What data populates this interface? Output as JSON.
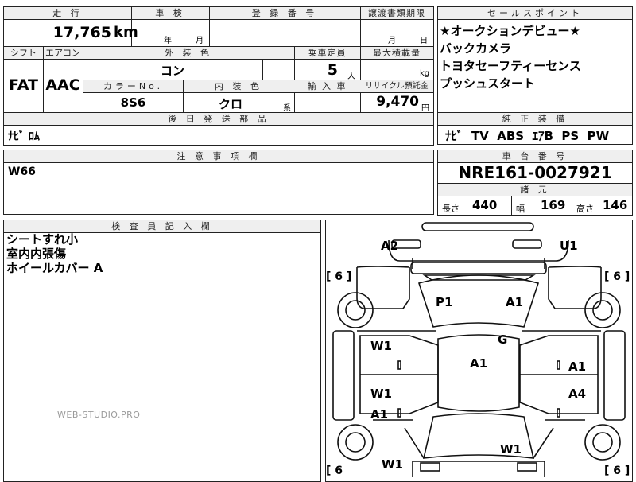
{
  "top": {
    "mileage_label": "走 行",
    "mileage_value": "17,765",
    "mileage_unit": "km",
    "shaken_label": "車 検",
    "shaken_year_unit": "年",
    "shaken_month_unit": "月",
    "reg_label": "登 録 番 号",
    "transfer_label": "譲渡書類期限",
    "transfer_month_unit": "月",
    "transfer_day_unit": "日"
  },
  "row2": {
    "shift_label": "シフト",
    "shift_value": "FAT",
    "ac_label": "エアコン",
    "ac_value": "AAC",
    "exterior_label": "外 装 色",
    "exterior_value": "コン",
    "capacity_label": "乗車定員",
    "capacity_value": "5",
    "capacity_unit": "人",
    "maxload_label": "最大積載量",
    "maxload_unit": "kg",
    "colorno_label": "カラーNo.",
    "colorno_value": "8S6",
    "interior_label": "内 装 色",
    "interior_value": "クロ",
    "interior_suffix": "系",
    "import_label": "輸 入 車",
    "recycle_label": "リサイクル預託金",
    "recycle_value": "9,470",
    "recycle_unit": "円"
  },
  "later": {
    "label": "後 日 発 送 部 品",
    "value": "ﾅﾋﾞ ﾛﾑ"
  },
  "notes": {
    "label": "注 意 事 項 欄",
    "value": "W66"
  },
  "inspector": {
    "label": "検 査 員 記 入 欄",
    "lines": [
      "シートすれ小",
      "室内内張傷",
      "ホイールカバー A"
    ]
  },
  "sales": {
    "label": "セールスポイント",
    "points": [
      "★オークションデビュー★",
      "バックカメラ",
      "トヨタセーフティーセンス",
      "プッシュスタート"
    ]
  },
  "equip": {
    "label": "純 正 装 備",
    "value": "ﾅﾋﾞ  TV  ABS  ｴｱB  PS  PW"
  },
  "chassis": {
    "label": "車 台 番 号",
    "value": "NRE161-0027921"
  },
  "specs": {
    "label": "諸 元",
    "length_label": "長さ",
    "length_value": "440",
    "width_label": "幅",
    "width_value": "169",
    "height_label": "高さ",
    "height_value": "146"
  },
  "diagram": {
    "tire_tl": "[ 6 ]",
    "tire_tr": "[ 6 ]",
    "tire_bl": "[ 6",
    "tire_br": "[ 6 ]",
    "marks": {
      "a2": "A2",
      "u1": "U1",
      "p1": "P1",
      "a1_hood": "A1",
      "g": "G",
      "a1_roof": "A1",
      "w1_left_front": "W1",
      "a1_right_front": "A1",
      "w1_left_rear": "W1",
      "a1_left_rear": "A1",
      "a4_right_rear": "A4",
      "w1_rear_glass": "W1",
      "w1_bottom": "W1"
    }
  },
  "watermark": "WEB-STUDIO.PRO"
}
